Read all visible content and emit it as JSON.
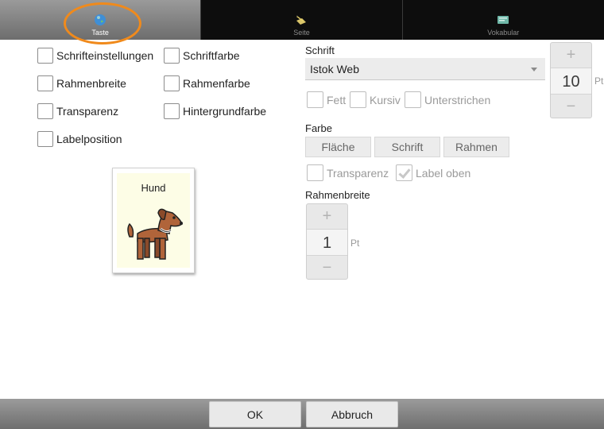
{
  "tabs": [
    {
      "label": "Taste",
      "icon": "globe-icon",
      "active": true
    },
    {
      "label": "Seite",
      "icon": "page-pen-icon",
      "active": false
    },
    {
      "label": "Vokabular",
      "icon": "vocabulary-icon",
      "active": false
    }
  ],
  "highlight_color": "#f08a1c",
  "left_options": [
    {
      "label": "Schrifteinstellungen",
      "checked": false
    },
    {
      "label": "Schriftfarbe",
      "checked": false
    },
    {
      "label": "Rahmenbreite",
      "checked": false
    },
    {
      "label": "Rahmenfarbe",
      "checked": false
    },
    {
      "label": "Transparenz",
      "checked": false
    },
    {
      "label": "Hintergrundfarbe",
      "checked": false
    },
    {
      "label": "Labelposition",
      "checked": false
    }
  ],
  "preview": {
    "label": "Hund",
    "background": "#fdfde6",
    "image": "dog-icon"
  },
  "font": {
    "section_title": "Schrift",
    "family": "Istok Web",
    "size_value": "10",
    "size_unit": "Pt",
    "styles": [
      {
        "label": "Fett",
        "checked": false
      },
      {
        "label": "Kursiv",
        "checked": false
      },
      {
        "label": "Unterstrichen",
        "checked": false
      }
    ]
  },
  "color": {
    "section_title": "Farbe",
    "buttons": [
      "Fläche",
      "Schrift",
      "Rahmen"
    ],
    "options": [
      {
        "label": "Transparenz",
        "checked": false
      },
      {
        "label": "Label oben",
        "checked": true
      }
    ]
  },
  "border": {
    "section_title": "Rahmenbreite",
    "value": "1",
    "unit": "Pt"
  },
  "stepper_symbols": {
    "plus": "+",
    "minus": "−"
  },
  "footer": {
    "ok_label": "OK",
    "cancel_label": "Abbruch"
  }
}
